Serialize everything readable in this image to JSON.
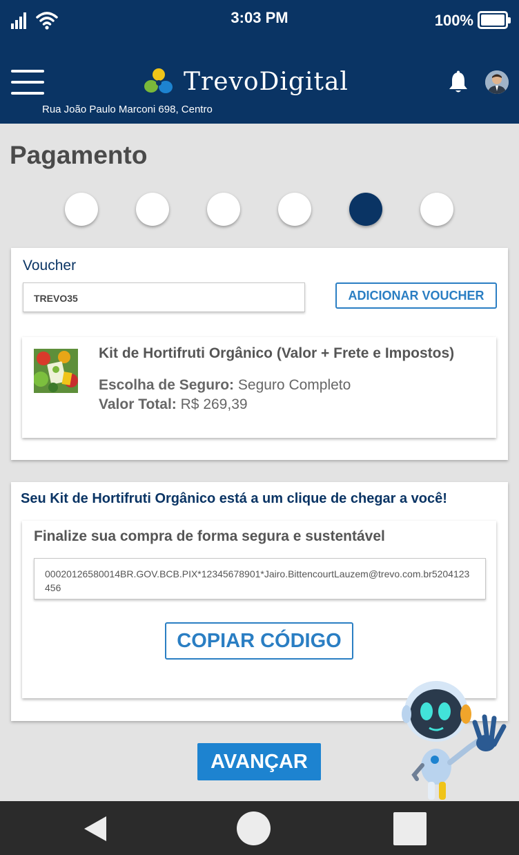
{
  "status_bar": {
    "time": "3:03 PM",
    "battery": "100%",
    "icons": [
      "signal-icon",
      "wifi-icon",
      "battery-icon"
    ]
  },
  "header": {
    "brand": "TrevoDigital",
    "address": "Rua João Paulo Marconi 698, Centro",
    "icons": [
      "menu-icon",
      "clover-logo-icon",
      "bell-icon",
      "avatar"
    ]
  },
  "page": {
    "title": "Pagamento",
    "steps_total": 6,
    "active_step": 5
  },
  "voucher": {
    "title": "Voucher",
    "input_value": "TREVO35",
    "button_label": "ADICIONAR VOUCHER"
  },
  "product": {
    "name": "Kit de Hortifruti Orgânico (Valor + Frete e Impostos)",
    "insurance_label": "Escolha de Seguro:",
    "insurance_value": "Seguro Completo",
    "total_label": "Valor Total:",
    "total_value": "R$ 269,39"
  },
  "pix": {
    "headline": "Seu Kit de Hortifruti Orgânico está a um clique de chegar a você!",
    "subtitle": "Finalize sua compra de forma segura e sustentável",
    "code": "00020126580014BR.GOV.BCB.PIX*12345678901*Jairo.BittencourtLauzem@trevo.com.br5204123456",
    "copy_button": "COPIAR CÓDIGO"
  },
  "advance_button": "AVANÇAR",
  "colors": {
    "header_bg": "#0a3464",
    "accent_blue": "#2a7ec3",
    "primary_button": "#1d83d0",
    "page_bg": "#e3e3e3"
  }
}
